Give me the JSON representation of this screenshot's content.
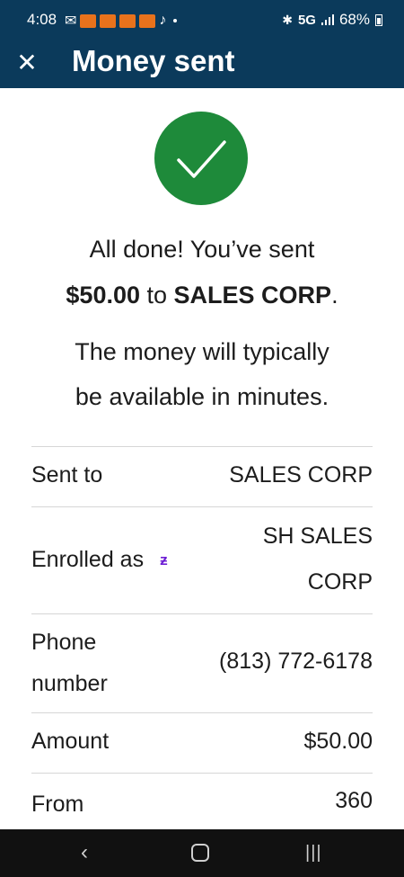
{
  "status": {
    "time": "4:08",
    "network": "5G",
    "battery": "68%"
  },
  "header": {
    "title": "Money sent",
    "close_icon": "close-icon"
  },
  "confirmation": {
    "line1": "All done! You’ve sent",
    "amount": "$50.00",
    "to_word": " to ",
    "recipient": "SALES CORP",
    "period": ".",
    "note_line1": "The money will typically",
    "note_line2": "be available in minutes."
  },
  "details": {
    "sent_to_label": "Sent to",
    "sent_to_value": "SALES CORP",
    "enrolled_label": "Enrolled as",
    "enrolled_value_1": "SH SALES",
    "enrolled_value_2": "CORP",
    "phone_label_1": "Phone",
    "phone_label_2": "number",
    "phone_value": "(813) 772-6178",
    "amount_label": "Amount",
    "amount_value": "$50.00",
    "from_label": "From",
    "from_value": "360"
  },
  "colors": {
    "header_bg": "#0b3a5b",
    "success_green": "#1e8a3a",
    "zelle_purple": "#6d1ed4"
  }
}
